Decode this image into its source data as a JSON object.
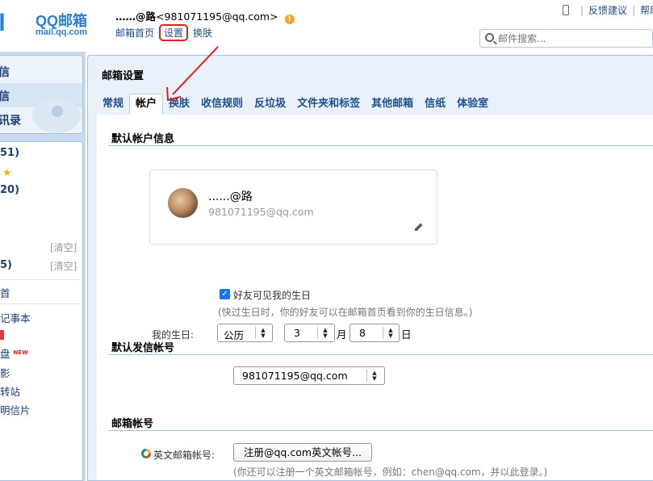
{
  "header": {
    "logo_mark": "il",
    "brand": "QQ邮箱",
    "domain": "mail.qq.com",
    "user_nick": "……@路",
    "user_email": "<981071195@qq.com>",
    "warn_icon": "!",
    "links": {
      "home": "邮箱首页",
      "settings": "设置",
      "skin": "换肤"
    },
    "right_links": {
      "feedback": "反馈建议",
      "help": "帮助"
    },
    "search_placeholder": "邮件搜索..."
  },
  "nav": {
    "top_items": [
      "信",
      "信",
      "讯录"
    ],
    "rows": [
      {
        "text": "51)",
        "bold": true
      },
      {
        "text": "",
        "star": true
      },
      {
        "text": "20)",
        "bold": true
      },
      {
        "text": "",
        "clear": "[清空]"
      },
      {
        "text": "5)",
        "bold": true,
        "clear": "[清空]"
      },
      {
        "text": "首"
      },
      {
        "text": "记事本"
      },
      {
        "text": "",
        "redbox": true
      },
      {
        "text": "盘",
        "new": "NEW"
      },
      {
        "text": "影"
      },
      {
        "text": "转站"
      },
      {
        "text": "明信片"
      }
    ]
  },
  "main": {
    "title": "邮箱设置",
    "tabs": [
      "常规",
      "帐户",
      "换肤",
      "收信规则",
      "反垃圾",
      "文件夹和标签",
      "其他邮箱",
      "信纸",
      "体验室"
    ],
    "active_tab": "帐户",
    "section_default_account": "默认帐户信息",
    "card_name": "......@路",
    "card_email": "981071195@qq.com",
    "birthday_label": "我的生日:",
    "calendar_value": "公历",
    "month_value": "3",
    "month_unit": "月",
    "day_value": "8",
    "day_unit": "日",
    "checkbox_label": "好友可见我的生日",
    "birthday_hint": "(快过生日时，你的好友可以在邮箱首页看到你的生日信息。)",
    "section_default_send": "默认发信帐号",
    "send_account_value": "981071195@qq.com",
    "section_mail_account": "邮箱帐号",
    "english_label": "英文邮箱帐号:",
    "register_button": "注册@qq.com英文帐号...",
    "register_hint": "(你还可以注册一个英文邮箱帐号，例如：chen@qq.com，并以此登录。)"
  },
  "colors": {
    "accent_blue": "#2b7ed8",
    "link_blue": "#1e4e8c",
    "annotation_red": "#e02020"
  }
}
